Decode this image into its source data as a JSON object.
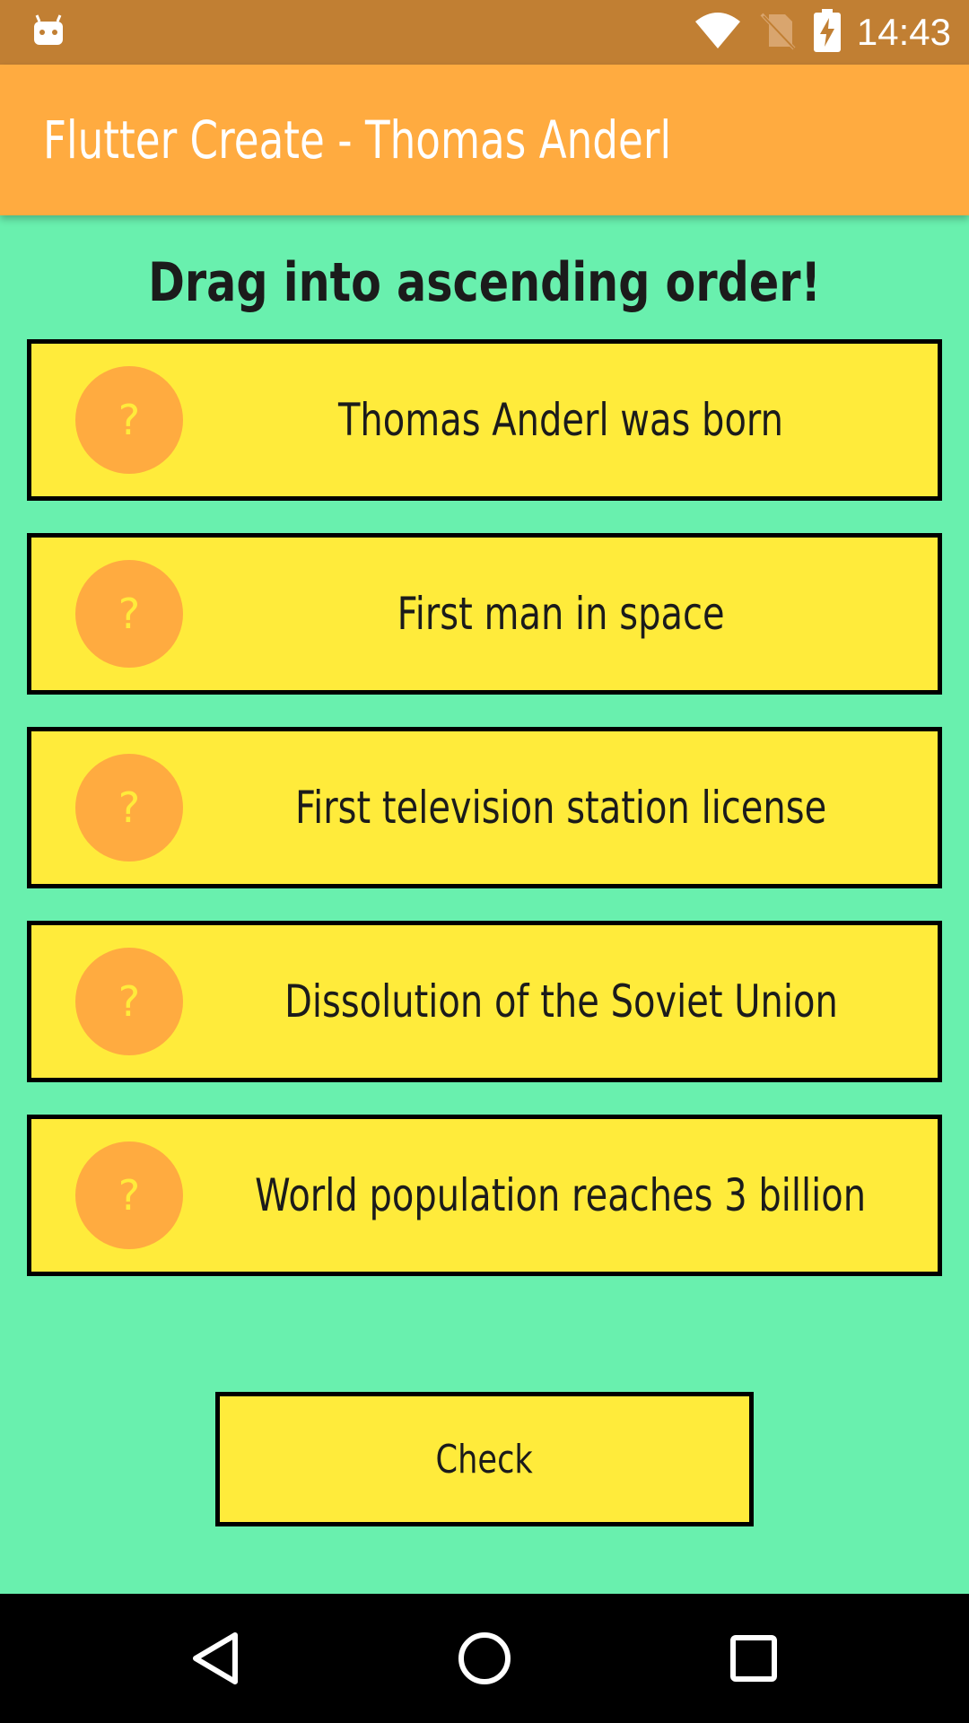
{
  "status_bar": {
    "time": "14:43",
    "icons": [
      "android-notification-icon",
      "wifi-icon",
      "no-sim-icon",
      "battery-charging-icon"
    ]
  },
  "app_bar": {
    "title": "Flutter Create - Thomas Anderl"
  },
  "main": {
    "instruction": "Drag into ascending order!",
    "items": [
      {
        "badge": "?",
        "label": "Thomas Anderl was born"
      },
      {
        "badge": "?",
        "label": "First man in space"
      },
      {
        "badge": "?",
        "label": "First television station license"
      },
      {
        "badge": "?",
        "label": "Dissolution of the Soviet Union"
      },
      {
        "badge": "?",
        "label": "World population reaches 3 billion"
      }
    ],
    "check_label": "Check"
  },
  "nav_bar": {
    "buttons": [
      "back-icon",
      "home-icon",
      "recents-icon"
    ]
  },
  "colors": {
    "background": "#69F0AE",
    "app_bar": "#FFAB40",
    "status_bar": "#C17F33",
    "card": "#FFEB3B",
    "badge": "#FFAB40"
  }
}
